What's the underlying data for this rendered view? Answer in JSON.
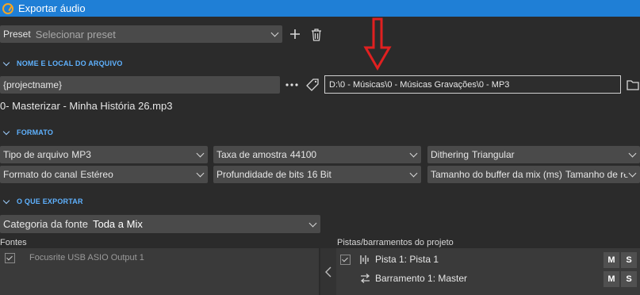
{
  "window": {
    "title": "Exportar áudio"
  },
  "preset": {
    "label": "Preset",
    "placeholder": "Selecionar preset"
  },
  "sections": {
    "name_location": "NOME E LOCAL DO ARQUIVO",
    "format": "FORMATO",
    "what_export": "O QUE EXPORTAR"
  },
  "file": {
    "name_template": "{projectname}",
    "path": "D:\\0 - Músicas\\0 - Músicas Gravações\\0 - MP3",
    "resolved_name": "0- Masterizar - Minha História 26.mp3"
  },
  "format": {
    "file_type": {
      "label": "Tipo de arquivo",
      "value": "MP3"
    },
    "sample_rate": {
      "label": "Taxa de amostra",
      "value": "44100"
    },
    "dithering": {
      "label": "Dithering",
      "value": "Triangular"
    },
    "channel_format": {
      "label": "Formato do canal",
      "value": "Estéreo"
    },
    "bit_depth": {
      "label": "Profundidade de bits",
      "value": "16 Bit"
    },
    "buffer_size": {
      "label": "Tamanho do buffer da mix (ms)",
      "value": "Tamanho de re"
    }
  },
  "source": {
    "label": "Categoria da fonte",
    "value": "Toda a Mix"
  },
  "sources_panel": {
    "title": "Fontes",
    "items": [
      {
        "label": "Focusrite USB ASIO Output 1"
      }
    ]
  },
  "tracks_panel": {
    "title": "Pistas/barramentos do projeto",
    "items": [
      {
        "label": "Pista 1: Pista 1",
        "mute": "M",
        "solo": "S"
      },
      {
        "label": "Barramento 1: Master",
        "mute": "M",
        "solo": "S"
      }
    ]
  },
  "colors": {
    "titlebar": "#1f7fd6",
    "accent_text": "#5fb2ff",
    "arrow": "#e02020"
  }
}
